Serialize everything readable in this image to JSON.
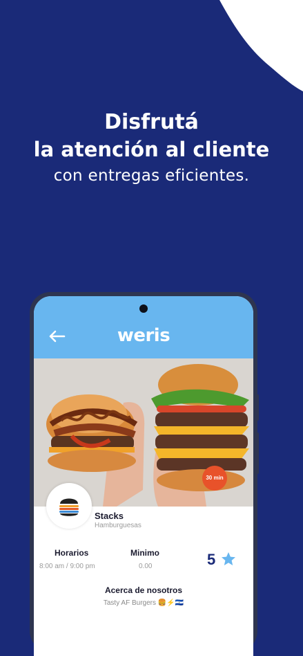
{
  "headline": {
    "line1": "Disfrutá",
    "line2": "la atención al cliente",
    "line3": "con entregas eficientes."
  },
  "app": {
    "logo": "weris",
    "hero_badge": "30 min"
  },
  "restaurant": {
    "name": "Stacks",
    "category": "Hamburguesas",
    "hours_label": "Horarios",
    "hours_value": "8:00 am / 9:00 pm",
    "minimum_label": "Minimo",
    "minimum_value": "0.00",
    "rating": "5",
    "about_label": "Acerca de nosotros",
    "about_text": "Tasty AF Burgers 🍔⚡🇸🇻"
  },
  "colors": {
    "background": "#1a2a78",
    "appbar": "#68b6ef",
    "accent_orange": "#e8522a",
    "star": "#68b6ef"
  }
}
